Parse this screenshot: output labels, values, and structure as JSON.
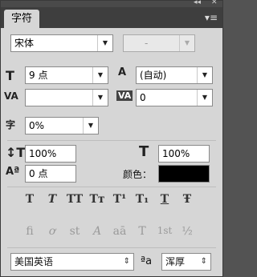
{
  "header": {
    "tab_label": "字符",
    "collapse_glyph": "◂◂",
    "close_glyph": "✕",
    "menu_glyph": "▾≡"
  },
  "font": {
    "family": "宋体",
    "style": "-"
  },
  "size": {
    "value": "9 点",
    "leading": "(自动)"
  },
  "kerning": {
    "value": "",
    "tracking": "0"
  },
  "scale_tsume": {
    "value": "0%"
  },
  "vertical_scale": {
    "value": "100%"
  },
  "horizontal_scale": {
    "value": "100%"
  },
  "baseline_shift": {
    "value": "0 点"
  },
  "color": {
    "label": "颜色：",
    "swatch": "#000000"
  },
  "type_style_buttons": [
    "T",
    "T",
    "TT",
    "Tт",
    "T¹",
    "T₁",
    "T",
    "Ŧ"
  ],
  "opentype_buttons": [
    "fi",
    "ơ",
    "st",
    "A",
    "aā",
    "T",
    "1st",
    "½"
  ],
  "language": {
    "value": "美国英语",
    "aa_label": "ªa",
    "antialias": "浑厚"
  },
  "icons": {
    "size": "T",
    "leading": "A",
    "kerning": "VA",
    "tracking": "VA",
    "tsume": "字"
  }
}
